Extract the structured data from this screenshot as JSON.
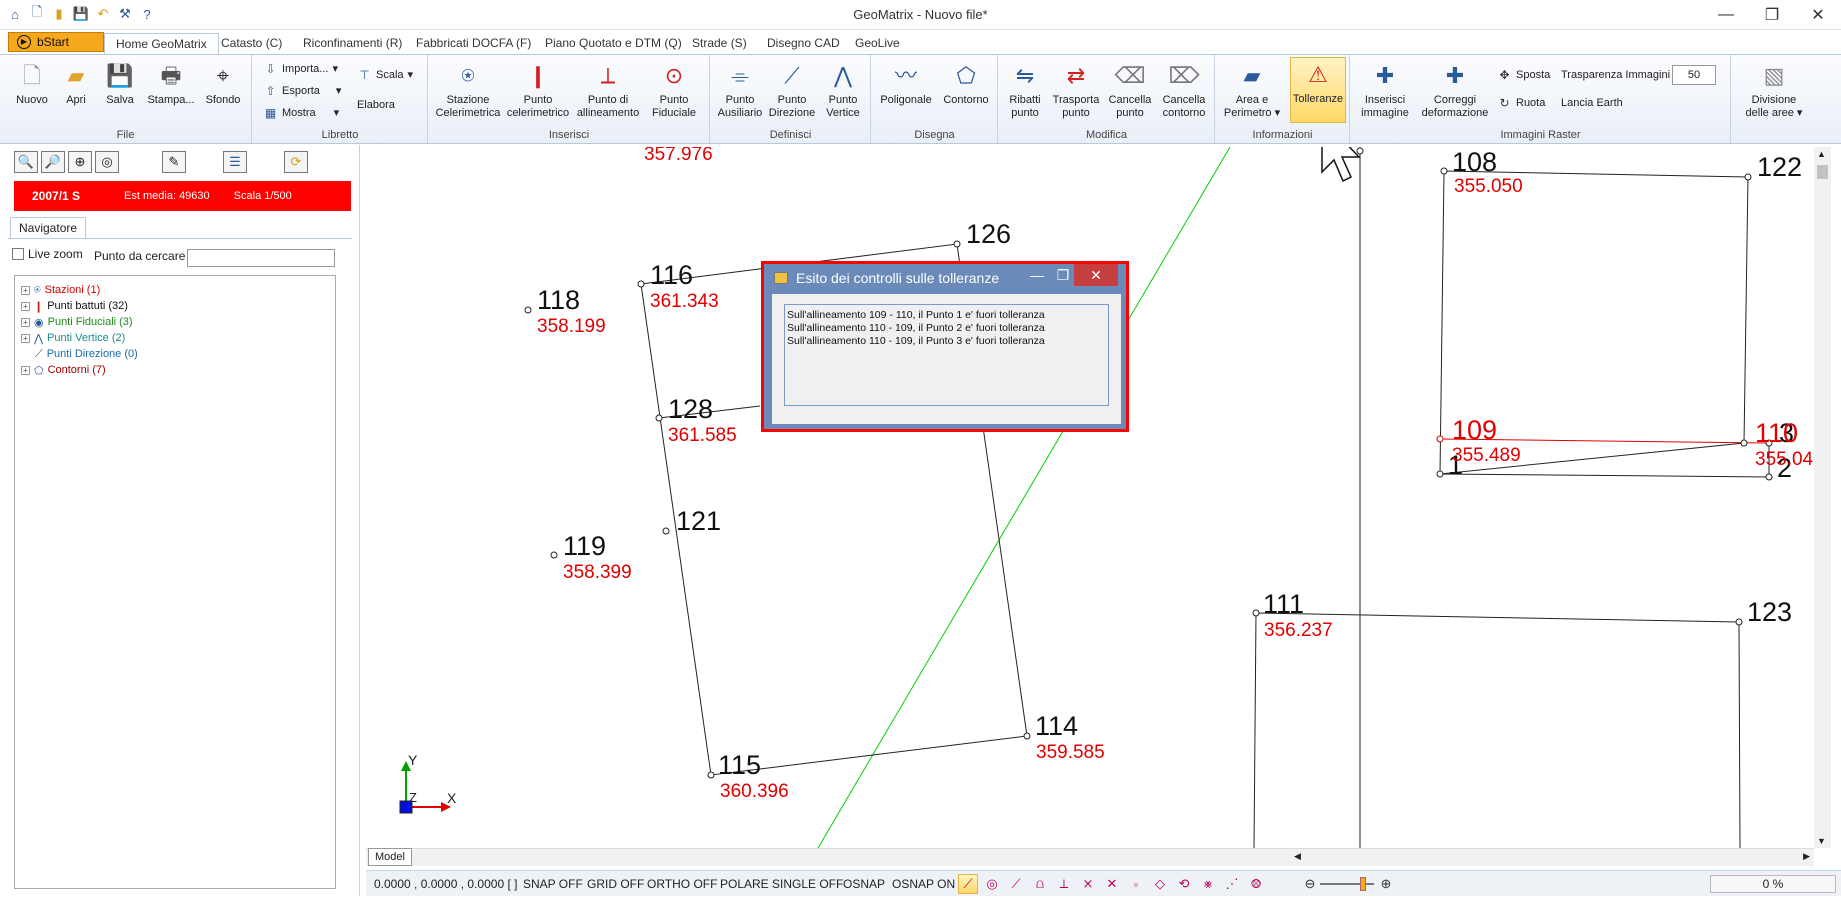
{
  "window": {
    "title": "GeoMatrix - Nuovo file*",
    "minimize": "—",
    "maximize": "❐",
    "close": "✕"
  },
  "qat_icons": [
    "app-icon",
    "new-file-icon",
    "open-folder-icon",
    "save-icon",
    "undo-icon",
    "tools-icon",
    "help-icon"
  ],
  "tabs": {
    "start": "bStart",
    "items": [
      "Home GeoMatrix",
      "Catasto (C)",
      "Riconfinamenti (R)",
      "Fabbricati DOCFA (F)",
      "Piano Quotato e DTM (Q)",
      "Strade (S)",
      "Disegno CAD",
      "GeoLive"
    ]
  },
  "ribbon": {
    "file": {
      "label": "File",
      "nuovo": "Nuovo",
      "apri": "Apri",
      "salva": "Salva",
      "stampa": "Stampa...",
      "sfondo": "Sfondo"
    },
    "libretto": {
      "label": "Libretto",
      "importa": "Importa...",
      "esporta": "Esporta",
      "mostra": "Mostra",
      "scala": "Scala",
      "elabora": "Elabora"
    },
    "inserisci": {
      "label": "Inserisci",
      "stazione_1": "Stazione",
      "stazione_2": "Celerimetrica",
      "punto_cel_1": "Punto",
      "punto_cel_2": "celerimetrico",
      "punto_all_1": "Punto di",
      "punto_all_2": "allineamento",
      "punto_fid_1": "Punto",
      "punto_fid_2": "Fiduciale"
    },
    "definisci": {
      "label": "Definisci",
      "aus_1": "Punto",
      "aus_2": "Ausiliario",
      "dir_1": "Punto",
      "dir_2": "Direzione",
      "ver_1": "Punto",
      "ver_2": "Vertice"
    },
    "disegna": {
      "label": "Disegna",
      "poligonale": "Poligonale",
      "contorno": "Contorno"
    },
    "modifica": {
      "label": "Modifica",
      "ribatti_1": "Ribatti",
      "ribatti_2": "punto",
      "trasporta_1": "Trasporta",
      "trasporta_2": "punto",
      "cancella_1": "Cancella",
      "cancella_2": "punto",
      "canccont_1": "Cancella",
      "canccont_2": "contorno"
    },
    "informazioni": {
      "label": "Informazioni",
      "area_1": "Area e",
      "area_2": "Perimetro",
      "tolleranze": "Tolleranze"
    },
    "raster": {
      "label": "Immagini Raster",
      "inserisci_1": "Inserisci",
      "inserisci_2": "immagine",
      "correggi_1": "Correggi",
      "correggi_2": "deformazione",
      "sposta": "Sposta",
      "ruota": "Ruota",
      "trasparenza": "Trasparenza Immagini",
      "trasparenza_value": "50",
      "lancia": "Lancia Earth"
    },
    "divisione": {
      "label_1": "Divisione",
      "label_2": "delle aree"
    }
  },
  "left": {
    "redbar": {
      "code": "2007/1 S",
      "est": "Est media: 49630",
      "scala": "Scala 1/500"
    },
    "nav_tab": "Navigatore",
    "live_zoom": "Live zoom",
    "punto_label": "Punto da cercare",
    "punto_value": "",
    "tree": [
      {
        "label": "Stazioni (1)",
        "color": "#e00000"
      },
      {
        "label": "Punti battuti (32)",
        "color": "#111111"
      },
      {
        "label": "Punti Fiduciali (3)",
        "color": "#1a8a1a"
      },
      {
        "label": "Punti Vertice (2)",
        "color": "#1a8a8a"
      },
      {
        "label": "Punti Direzione (0)",
        "color": "#1a6aa8"
      },
      {
        "label": "Contorni (7)",
        "color": "#a00000"
      }
    ]
  },
  "drawing": {
    "points": [
      {
        "id": "116",
        "elev": "361.343"
      },
      {
        "id": "126",
        "elev": ""
      },
      {
        "id": "118",
        "elev": "358.199"
      },
      {
        "id": "128",
        "elev": "361.585"
      },
      {
        "id": "121",
        "elev": ""
      },
      {
        "id": "119",
        "elev": "358.399"
      },
      {
        "id": "114",
        "elev": "359.585"
      },
      {
        "id": "115",
        "elev": "360.396"
      },
      {
        "id": "108",
        "elev": "355.050"
      },
      {
        "id": "122",
        "elev": ""
      },
      {
        "id": "109",
        "elev": "355.489"
      },
      {
        "id": "110",
        "elev": "355.04"
      },
      {
        "id": "3",
        "elev": ""
      },
      {
        "id": "1",
        "elev": ""
      },
      {
        "id": "2",
        "elev": ""
      },
      {
        "id": "111",
        "elev": "356.237"
      },
      {
        "id": "123",
        "elev": ""
      }
    ],
    "top_elev": "357.976",
    "axis": {
      "x": "X",
      "y": "Y",
      "z": "Z"
    }
  },
  "dialog": {
    "title": "Esito dei controlli sulle tolleranze",
    "lines": [
      "Sull'allineamento 109 - 110, il Punto 1 e' fuori tolleranza",
      "Sull'allineamento 110 - 109, il Punto 2 e' fuori tolleranza",
      "Sull'allineamento 110 - 109, il Punto 3 e' fuori tolleranza"
    ]
  },
  "status": {
    "model_tab": "Model",
    "coords": "0.0000 , 0.0000 , 0.0000 [ ]",
    "snap": "SNAP OFF",
    "grid": "GRID OFF",
    "ortho": "ORTHO OFF",
    "polare": "POLARE",
    "single": "SINGLE OFF",
    "osnap": "OSNAP",
    "osnap_on": "OSNAP ON",
    "progress": "0 %"
  }
}
